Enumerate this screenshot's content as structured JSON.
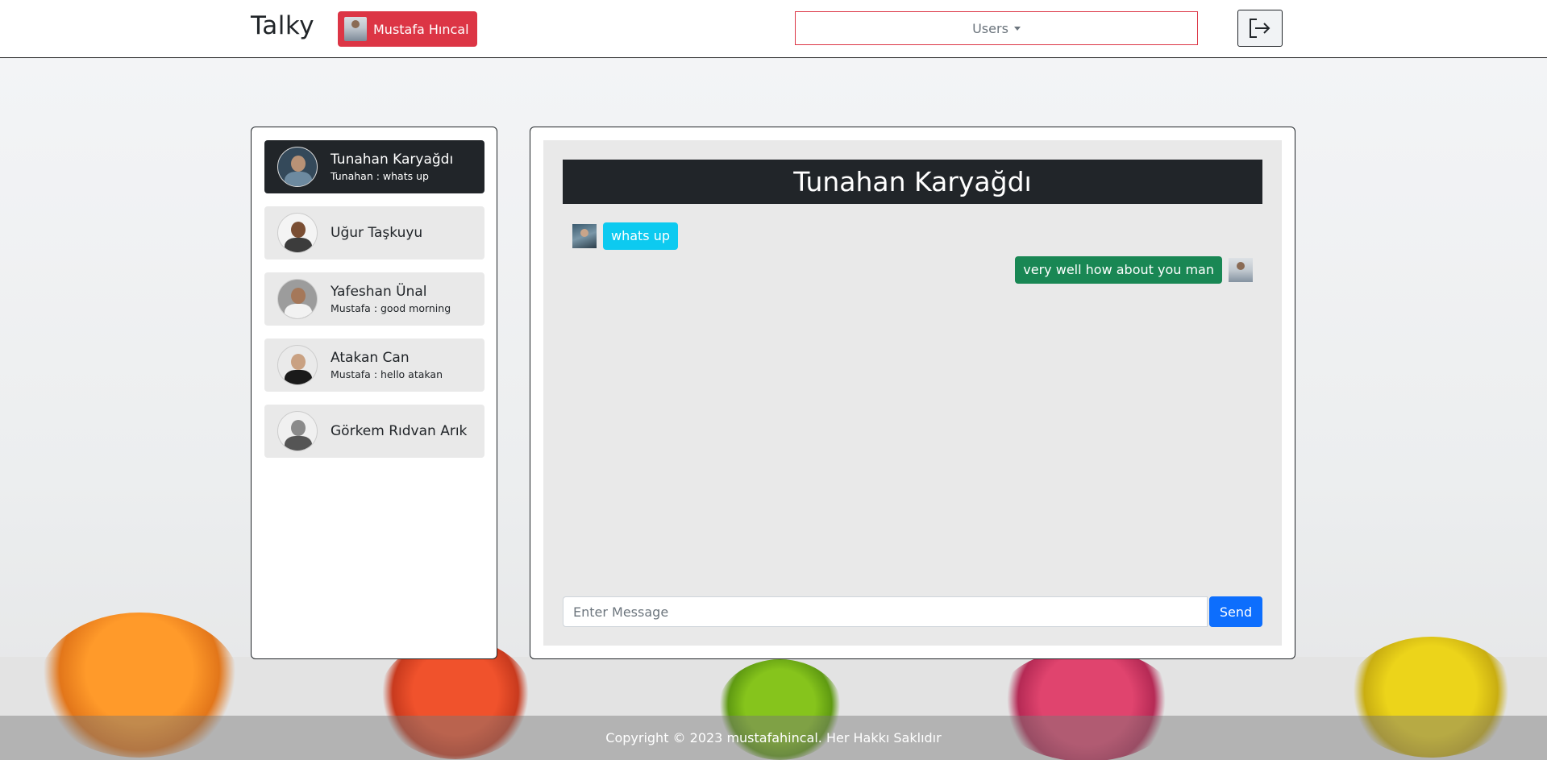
{
  "navbar": {
    "brand": "Talky",
    "current_user": "Mustafa Hıncal",
    "users_dropdown_label": "Users"
  },
  "sidebar": {
    "items": [
      {
        "name": "Tunahan Karyağdı",
        "preview": "Tunahan : whats up",
        "active": true
      },
      {
        "name": "Uğur Taşkuyu",
        "preview": "",
        "active": false
      },
      {
        "name": "Yafeshan Ünal",
        "preview": "Mustafa : good morning",
        "active": false
      },
      {
        "name": "Atakan Can",
        "preview": "Mustafa : hello atakan",
        "active": false
      },
      {
        "name": "Görkem Rıdvan Arık",
        "preview": "",
        "active": false
      }
    ]
  },
  "chat": {
    "title": "Tunahan Karyağdı",
    "messages": [
      {
        "direction": "incoming",
        "text": "whats up",
        "color": "#0dcaf0"
      },
      {
        "direction": "outgoing",
        "text": "very well how about you man",
        "color": "#198754"
      }
    ],
    "input_placeholder": "Enter Message",
    "send_label": "Send"
  },
  "footer": {
    "copyright": "Copyright © 2023 mustafahincal. Her Hakkı Saklıdır"
  },
  "colors": {
    "brand_red": "#dc3545",
    "active_dark": "#212529",
    "send_blue": "#0d6efd",
    "incoming_cyan": "#0dcaf0",
    "outgoing_green": "#198754"
  },
  "icons": {
    "logout": "logout-icon",
    "dropdown": "chevron-down-icon"
  }
}
